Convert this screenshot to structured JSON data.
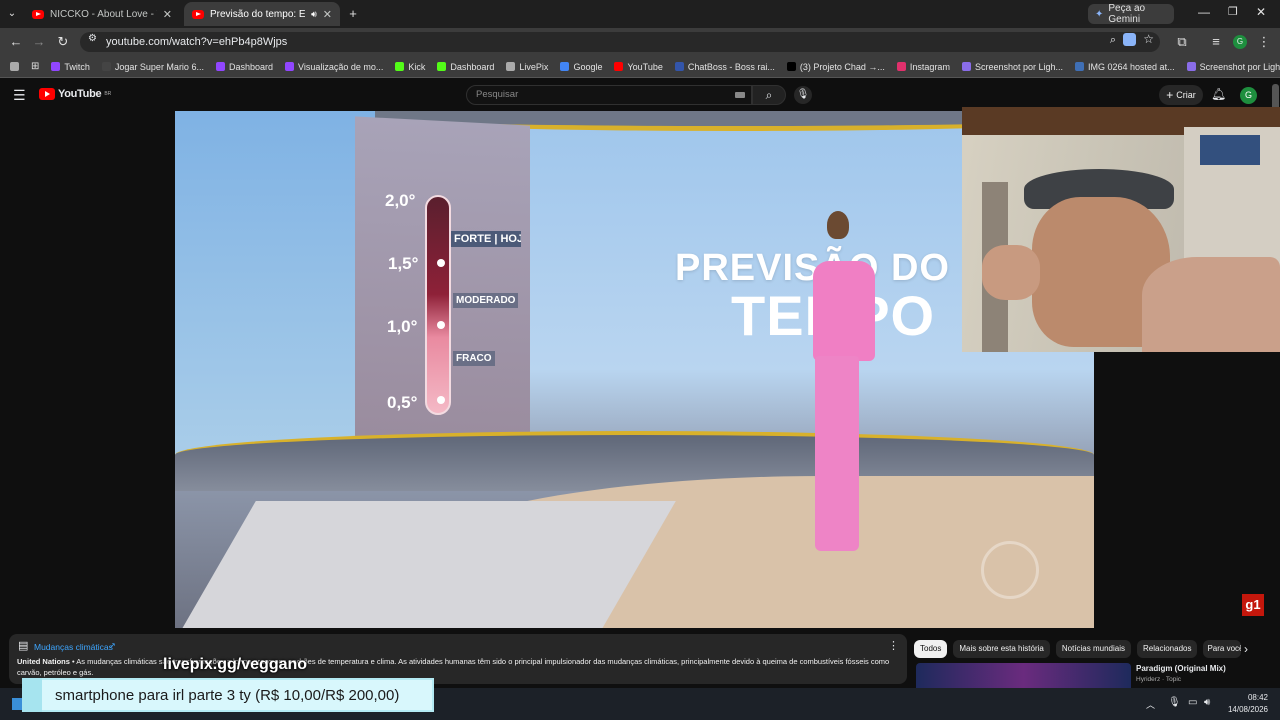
{
  "browser": {
    "tabs": [
      {
        "title": "NICCKO - About Love - YouTube",
        "active": false
      },
      {
        "title": "Previsão do tempo: El Niño",
        "active": true
      }
    ],
    "gemini_label": "Peça ao Gemini",
    "url": "youtube.com/watch?v=ehPb4p8Wjps",
    "bookmarks": [
      {
        "label": "Twitch",
        "color": "#9146ff"
      },
      {
        "label": "Jogar Super Mario 6...",
        "color": "#444"
      },
      {
        "label": "Dashboard",
        "color": "#9146ff"
      },
      {
        "label": "Visualização de mo...",
        "color": "#9146ff"
      },
      {
        "label": "Kick",
        "color": "#53fc18"
      },
      {
        "label": "Dashboard",
        "color": "#53fc18"
      },
      {
        "label": "LivePix",
        "color": "#aaaaaa"
      },
      {
        "label": "Google",
        "color": "#4285f4"
      },
      {
        "label": "YouTube",
        "color": "#ff0000"
      },
      {
        "label": "ChatBoss - Boss rai...",
        "color": "#3355aa"
      },
      {
        "label": "(3) Projeto Chad →...",
        "color": "#000000"
      },
      {
        "label": "Instagram",
        "color": "#e1306c"
      },
      {
        "label": "Screenshot por Ligh...",
        "color": "#8a6de9"
      },
      {
        "label": "IMG 0264 hosted at...",
        "color": "#3f6fb5"
      },
      {
        "label": "Screenshot por Ligh...",
        "color": "#8a6de9"
      }
    ]
  },
  "youtube": {
    "logo": "YouTube",
    "logo_suffix": "BR",
    "search_placeholder": "Pesquisar",
    "create_label": "Criar",
    "avatar_letter": "G"
  },
  "video": {
    "scale": [
      "2,0°",
      "1,5°",
      "1,0°",
      "0,5°"
    ],
    "labels": [
      "FORTE | HOJE",
      "MODERADO",
      "FRACO"
    ],
    "title_line1": "PREVISÃO DO",
    "title_line2": "TEMPO",
    "badge": "g1"
  },
  "info_panel": {
    "title": "Mudanças climáticas",
    "source": "United Nations",
    "text": " • As mudanças climáticas são transformações a longo prazo nos padrões de temperatura e clima. As atividades humanas têm sido o principal impulsionador das mudanças climáticas, principalmente devido à queima de combustíveis fósseis como carvão, petróleo e gás."
  },
  "chips": [
    "Todos",
    "Mais sobre esta história",
    "Notícias mundiais",
    "Relacionados",
    "Para você"
  ],
  "recommendation": {
    "title": "Paradigm (Original Mix)",
    "channel": "Hyriderz · Topic"
  },
  "overlay": {
    "livepix_url": "livepix.gg/veggano",
    "donation_text": "smartphone para irl parte 3 ty (R$ 10,00/R$ 200,00)"
  },
  "taskbar": {
    "time": "08:42",
    "date": "14/08/2026"
  }
}
